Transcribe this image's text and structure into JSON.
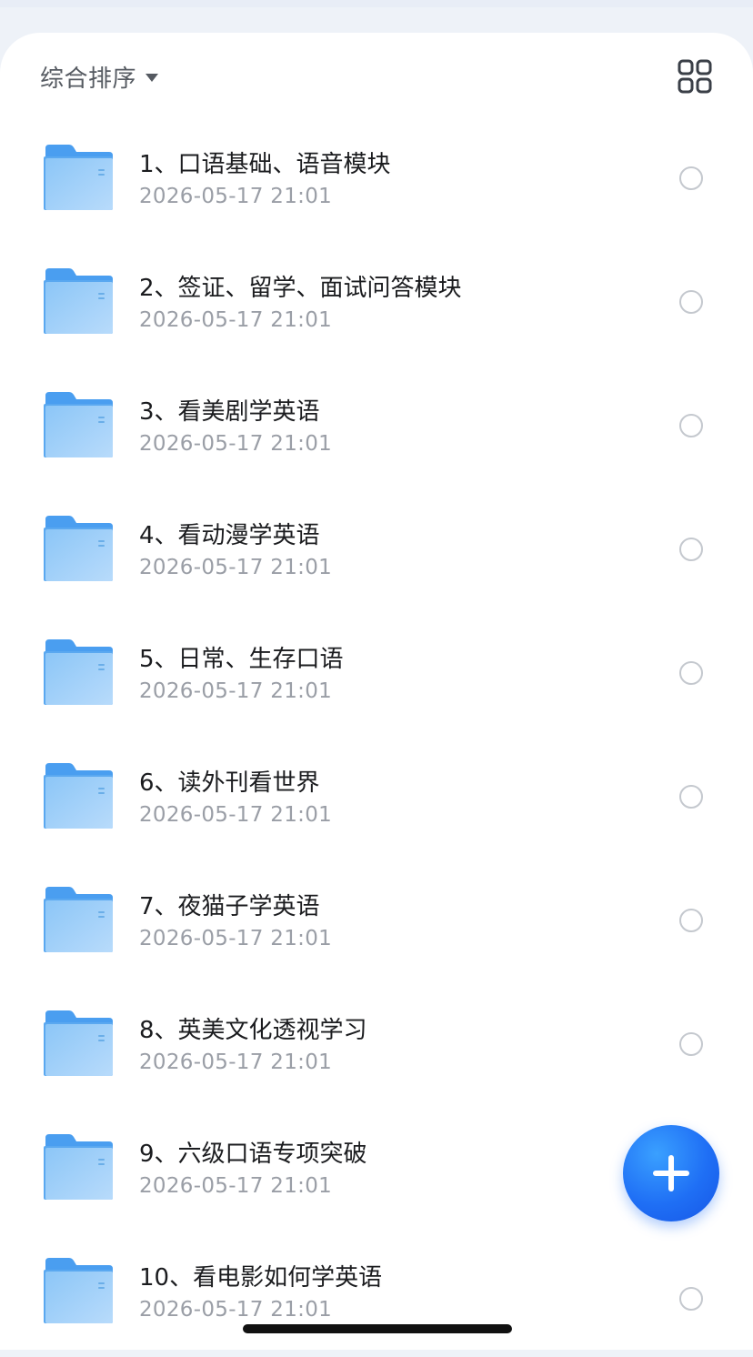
{
  "toolbar": {
    "sort_label": "综合排序",
    "sort_icon": "caret-down-icon",
    "view_toggle_icon": "grid-view-icon"
  },
  "colors": {
    "folder": "#6cb4f5",
    "accent": "#1f6ff5",
    "title_text": "#1b1c1f",
    "date_text": "#9a9ea6"
  },
  "files": [
    {
      "name": "1、口语基础、语音模块",
      "date": "2026-05-17 21:01",
      "icon": "folder-icon"
    },
    {
      "name": "2、签证、留学、面试问答模块",
      "date": "2026-05-17 21:01",
      "icon": "folder-icon"
    },
    {
      "name": "3、看美剧学英语",
      "date": "2026-05-17 21:01",
      "icon": "folder-icon"
    },
    {
      "name": "4、看动漫学英语",
      "date": "2026-05-17 21:01",
      "icon": "folder-icon"
    },
    {
      "name": "5、日常、生存口语",
      "date": "2026-05-17 21:01",
      "icon": "folder-icon"
    },
    {
      "name": "6、读外刊看世界",
      "date": "2026-05-17 21:01",
      "icon": "folder-icon"
    },
    {
      "name": "7、夜猫子学英语",
      "date": "2026-05-17 21:01",
      "icon": "folder-icon"
    },
    {
      "name": "8、英美文化透视学习",
      "date": "2026-05-17 21:01",
      "icon": "folder-icon"
    },
    {
      "name": "9、六级口语专项突破",
      "date": "2026-05-17 21:01",
      "icon": "folder-icon"
    },
    {
      "name": "10、看电影如何学英语",
      "date": "2026-05-17 21:01",
      "icon": "folder-icon"
    }
  ],
  "fab": {
    "icon": "plus-icon"
  }
}
